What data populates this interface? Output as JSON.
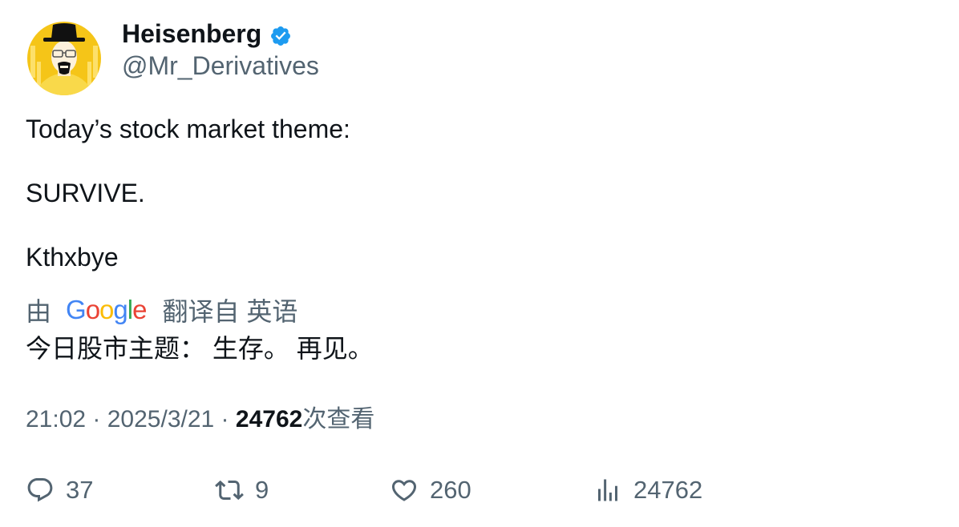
{
  "author": {
    "display_name": "Heisenberg",
    "handle": "@Mr_Derivatives",
    "verified": true,
    "avatar_icon": "heisenberg-avatar"
  },
  "tweet": {
    "lines": [
      "Today’s stock market theme:",
      "SURVIVE.",
      "Kthxbye"
    ]
  },
  "translation": {
    "by_label": "由",
    "provider": "Google",
    "from_label": "翻译自 英语",
    "text": "今日股市主题： 生存。 再见。"
  },
  "meta": {
    "time": "21:02",
    "separator1": " · ",
    "date": "2025/3/21",
    "separator2": " · ",
    "views": "24762",
    "views_label": "次查看"
  },
  "actions": {
    "replies": "37",
    "retweets": "9",
    "likes": "260",
    "views": "24762"
  },
  "colors": {
    "text": "#0f1419",
    "secondary": "#536471",
    "verified": "#1d9bf0",
    "avatar_bg": "#f5c518"
  }
}
